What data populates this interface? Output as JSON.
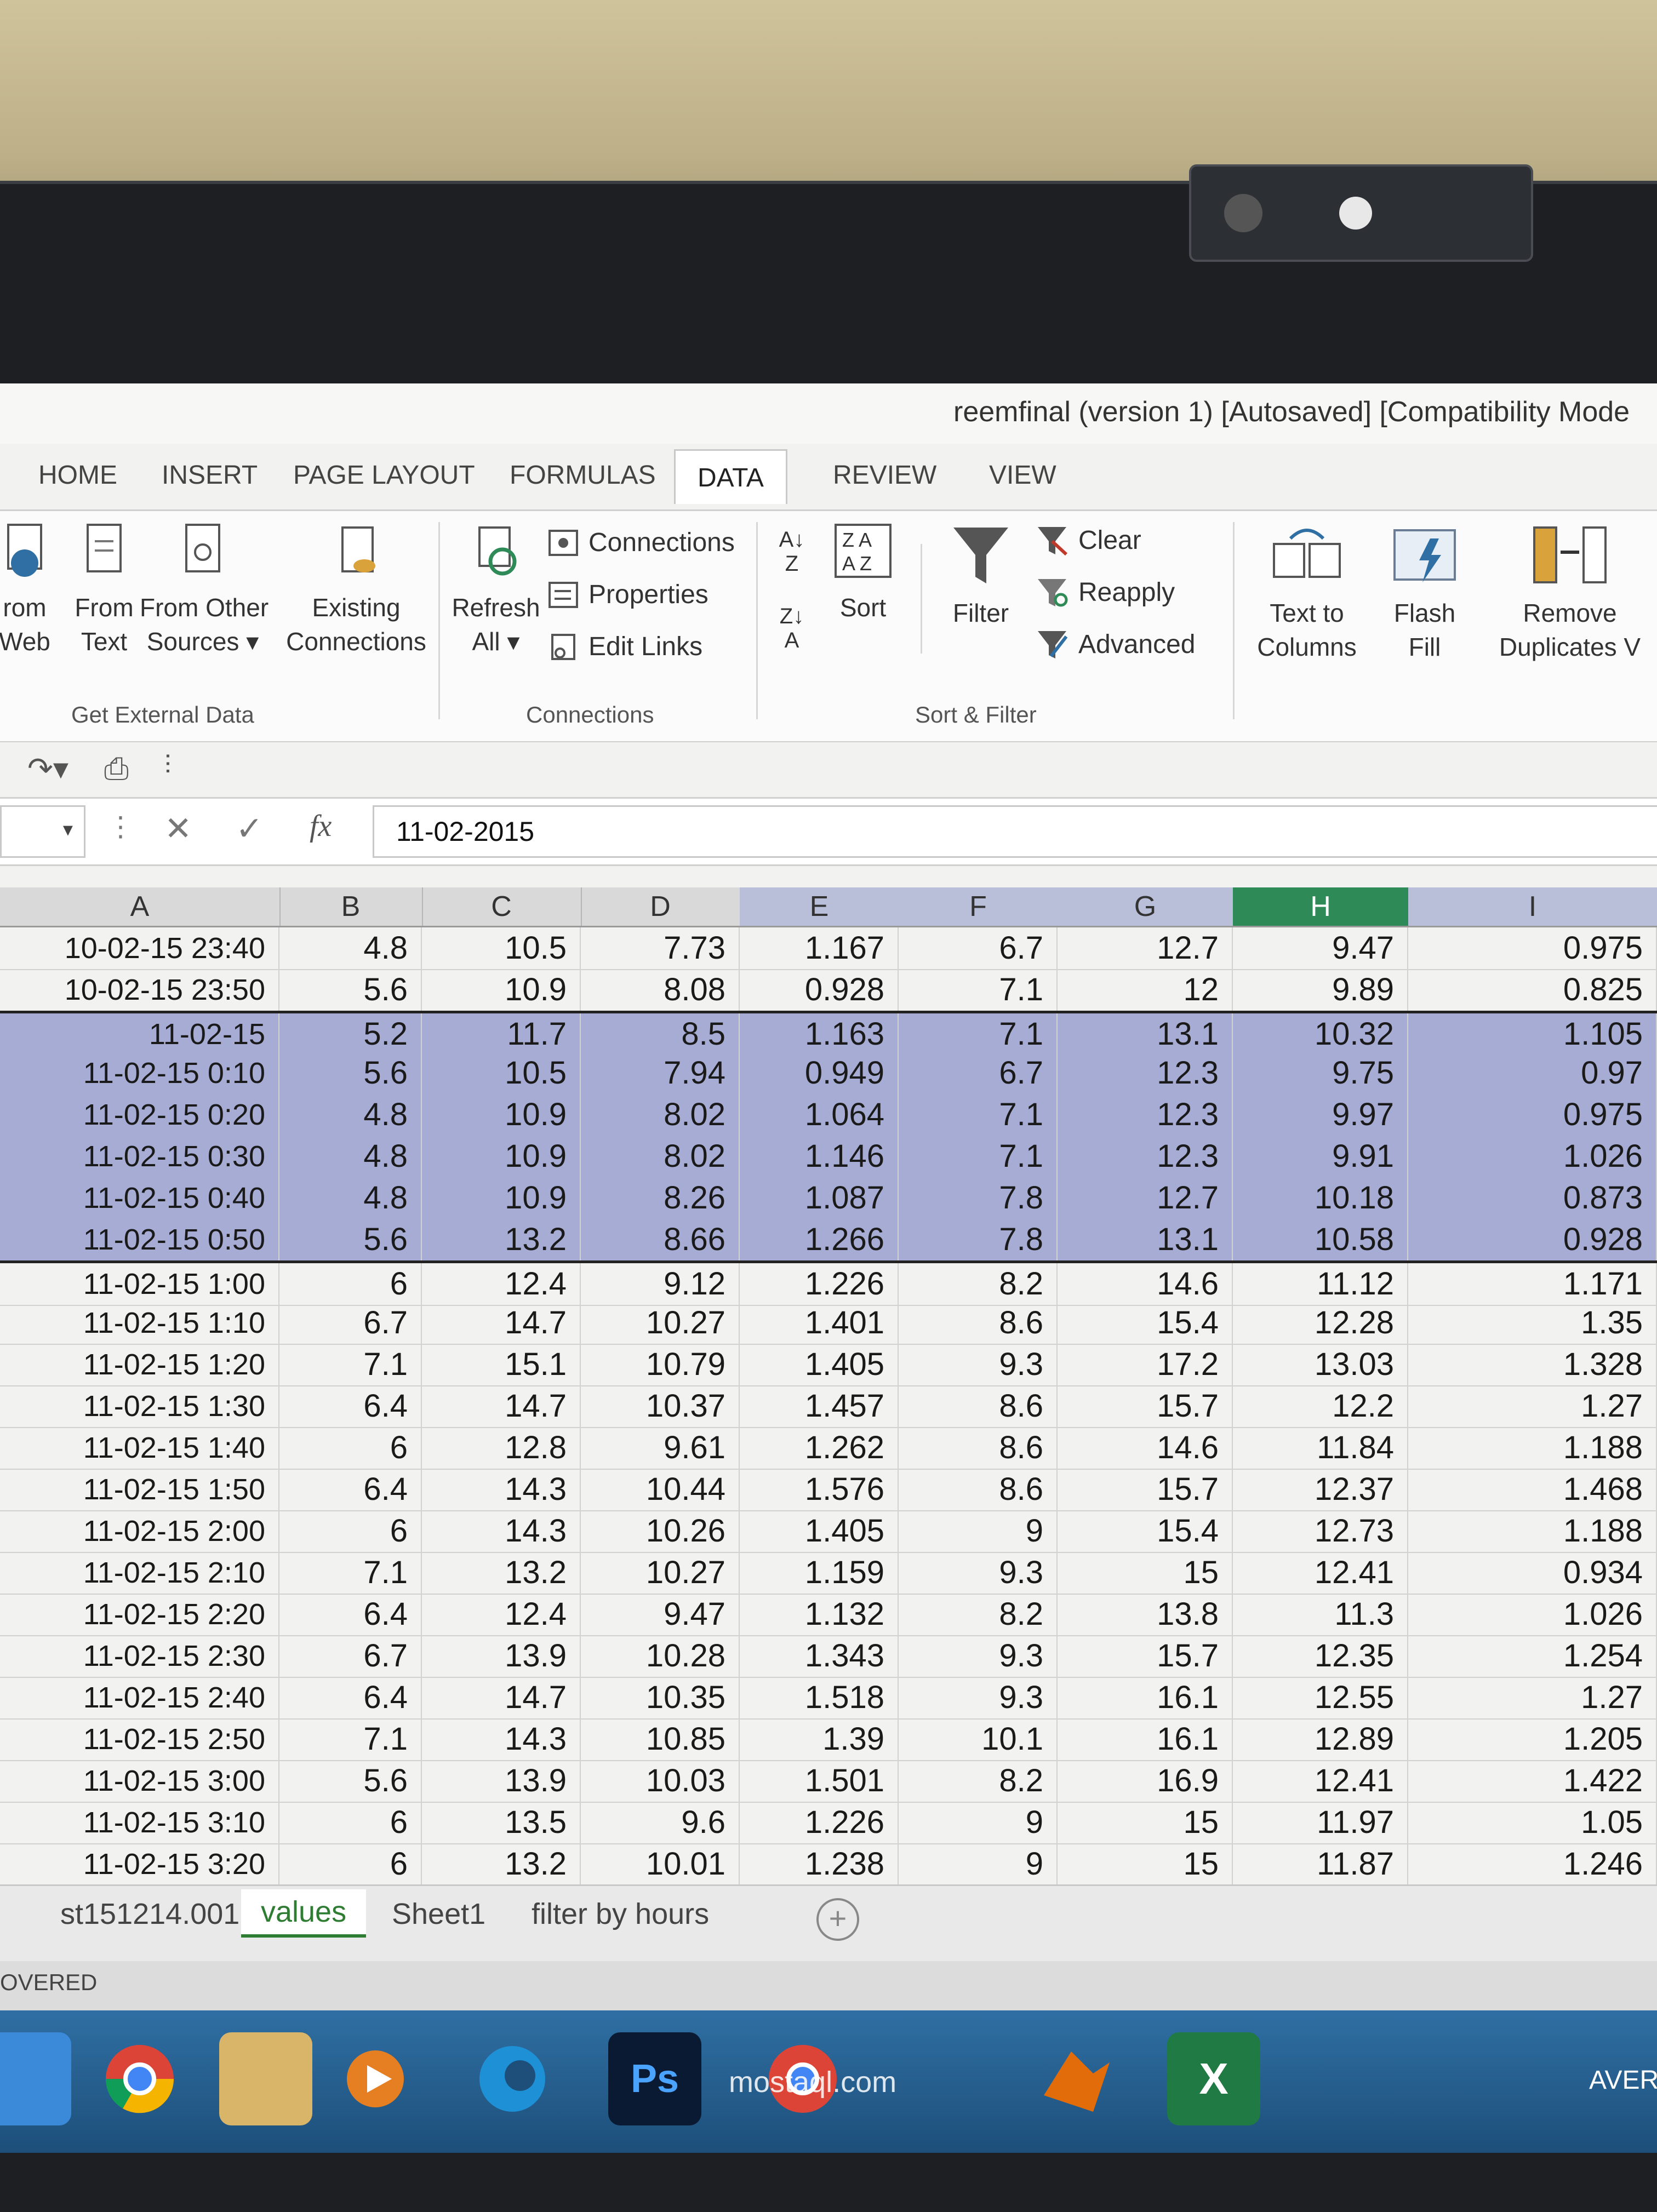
{
  "window": {
    "title": "reemfinal (version 1) [Autosaved]  [Compatibility Mode"
  },
  "tabs": [
    "HOME",
    "INSERT",
    "PAGE LAYOUT",
    "FORMULAS",
    "DATA",
    "REVIEW",
    "VIEW"
  ],
  "ribbon": {
    "get_external": {
      "from_web": "rom\nWeb",
      "from_text": "From\nText",
      "from_other": "From Other\nSources ▾",
      "existing": "Existing\nConnections",
      "label": "Get External Data"
    },
    "connections": {
      "refresh": "Refresh\nAll ▾",
      "connections": "Connections",
      "properties": "Properties",
      "edit_links": "Edit Links",
      "label": "Connections"
    },
    "sort_filter": {
      "sort": "Sort",
      "filter": "Filter",
      "clear": "Clear",
      "reapply": "Reapply",
      "advanced": "Advanced",
      "label": "Sort & Filter"
    },
    "data_tools": {
      "text_to_columns": "Text to\nColumns",
      "flash_fill": "Flash\nFill",
      "remove_duplicates": "Remove\nDuplicates V"
    }
  },
  "formula_bar": {
    "value": "11-02-2015"
  },
  "columns": [
    "A",
    "B",
    "C",
    "D",
    "E",
    "F",
    "G",
    "H",
    "I"
  ],
  "rows": [
    [
      "10-02-15 23:40",
      "4.8",
      "10.5",
      "7.73",
      "1.167",
      "6.7",
      "12.7",
      "9.47",
      "0.975"
    ],
    [
      "10-02-15 23:50",
      "5.6",
      "10.9",
      "8.08",
      "0.928",
      "7.1",
      "12",
      "9.89",
      "0.825"
    ],
    [
      "11-02-15",
      "5.2",
      "11.7",
      "8.5",
      "1.163",
      "7.1",
      "13.1",
      "10.32",
      "1.105"
    ],
    [
      "11-02-15 0:10",
      "5.6",
      "10.5",
      "7.94",
      "0.949",
      "6.7",
      "12.3",
      "9.75",
      "0.97"
    ],
    [
      "11-02-15 0:20",
      "4.8",
      "10.9",
      "8.02",
      "1.064",
      "7.1",
      "12.3",
      "9.97",
      "0.975"
    ],
    [
      "11-02-15 0:30",
      "4.8",
      "10.9",
      "8.02",
      "1.146",
      "7.1",
      "12.3",
      "9.91",
      "1.026"
    ],
    [
      "11-02-15 0:40",
      "4.8",
      "10.9",
      "8.26",
      "1.087",
      "7.8",
      "12.7",
      "10.18",
      "0.873"
    ],
    [
      "11-02-15 0:50",
      "5.6",
      "13.2",
      "8.66",
      "1.266",
      "7.8",
      "13.1",
      "10.58",
      "0.928"
    ],
    [
      "11-02-15 1:00",
      "6",
      "12.4",
      "9.12",
      "1.226",
      "8.2",
      "14.6",
      "11.12",
      "1.171"
    ],
    [
      "11-02-15 1:10",
      "6.7",
      "14.7",
      "10.27",
      "1.401",
      "8.6",
      "15.4",
      "12.28",
      "1.35"
    ],
    [
      "11-02-15 1:20",
      "7.1",
      "15.1",
      "10.79",
      "1.405",
      "9.3",
      "17.2",
      "13.03",
      "1.328"
    ],
    [
      "11-02-15 1:30",
      "6.4",
      "14.7",
      "10.37",
      "1.457",
      "8.6",
      "15.7",
      "12.2",
      "1.27"
    ],
    [
      "11-02-15 1:40",
      "6",
      "12.8",
      "9.61",
      "1.262",
      "8.6",
      "14.6",
      "11.84",
      "1.188"
    ],
    [
      "11-02-15 1:50",
      "6.4",
      "14.3",
      "10.44",
      "1.576",
      "8.6",
      "15.7",
      "12.37",
      "1.468"
    ],
    [
      "11-02-15 2:00",
      "6",
      "14.3",
      "10.26",
      "1.405",
      "9",
      "15.4",
      "12.73",
      "1.188"
    ],
    [
      "11-02-15 2:10",
      "7.1",
      "13.2",
      "10.27",
      "1.159",
      "9.3",
      "15",
      "12.41",
      "0.934"
    ],
    [
      "11-02-15 2:20",
      "6.4",
      "12.4",
      "9.47",
      "1.132",
      "8.2",
      "13.8",
      "11.3",
      "1.026"
    ],
    [
      "11-02-15 2:30",
      "6.7",
      "13.9",
      "10.28",
      "1.343",
      "9.3",
      "15.7",
      "12.35",
      "1.254"
    ],
    [
      "11-02-15 2:40",
      "6.4",
      "14.7",
      "10.35",
      "1.518",
      "9.3",
      "16.1",
      "12.55",
      "1.27"
    ],
    [
      "11-02-15 2:50",
      "7.1",
      "14.3",
      "10.85",
      "1.39",
      "10.1",
      "16.1",
      "12.89",
      "1.205"
    ],
    [
      "11-02-15 3:00",
      "5.6",
      "13.9",
      "10.03",
      "1.501",
      "8.2",
      "16.9",
      "12.41",
      "1.422"
    ],
    [
      "11-02-15 3:10",
      "6",
      "13.5",
      "9.6",
      "1.226",
      "9",
      "15",
      "11.97",
      "1.05"
    ],
    [
      "11-02-15 3:20",
      "6",
      "13.2",
      "10.01",
      "1.238",
      "9",
      "15",
      "11.87",
      "1.246"
    ]
  ],
  "sheet_tabs": [
    "st151214.001",
    "values",
    "Sheet1",
    "filter by hours"
  ],
  "status": "OVERED",
  "taskbar": {
    "ps_label": "Ps",
    "right_label": "AVER"
  },
  "watermark": "mostaql.com"
}
